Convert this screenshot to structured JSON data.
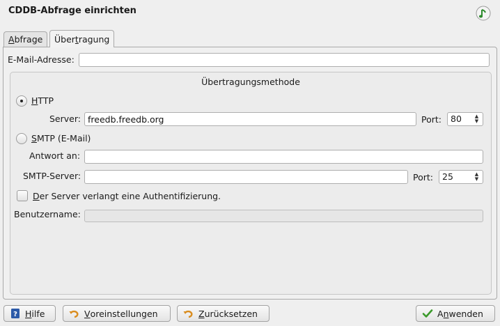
{
  "window": {
    "title": "CDDB-Abfrage einrichten",
    "icon": "music-note-icon"
  },
  "tabs": [
    {
      "label_pre": "",
      "label_ul": "A",
      "label_post": "bfrage",
      "active": false
    },
    {
      "label_pre": "Über",
      "label_ul": "t",
      "label_post": "ragung",
      "active": true
    }
  ],
  "email": {
    "label": "E-Mail-Adresse:",
    "value": ""
  },
  "method_group": {
    "title": "Übertragungsmethode",
    "http": {
      "label_ul": "H",
      "label_post": "TTP",
      "selected": true,
      "server_label": "Server:",
      "server_value": "freedb.freedb.org",
      "port_label": "Port:",
      "port_value": "80"
    },
    "smtp": {
      "label_ul": "S",
      "label_post": "MTP (E-Mail)",
      "selected": false,
      "reply_label": "Antwort an:",
      "reply_value": "",
      "server_label": "SMTP-Server:",
      "server_value": "",
      "port_label": "Port:",
      "port_value": "25"
    },
    "auth": {
      "label_ul": "D",
      "label_post": "er Server verlangt eine Authentifizierung.",
      "checked": false,
      "username_label": "Benutzername:",
      "username_value": ""
    }
  },
  "buttons": {
    "help": {
      "ul": "H",
      "rest": "ilfe",
      "icon": "help-book-icon"
    },
    "defaults": {
      "ul": "V",
      "rest": "oreinstellungen",
      "icon": "undo-arrow-icon"
    },
    "reset": {
      "ul": "Z",
      "rest": "urücksetzen",
      "icon": "reset-arrow-icon"
    },
    "apply": {
      "pre": "A",
      "ul": "n",
      "rest": "wenden",
      "icon": "checkmark-icon"
    }
  },
  "colors": {
    "accent_green": "#3a9a2a",
    "help_blue": "#2c5aa8",
    "reset_orange": "#d98c1e"
  }
}
